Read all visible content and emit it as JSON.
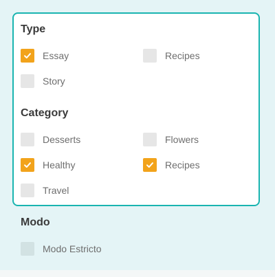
{
  "colors": {
    "accent": "#f2a31b",
    "panel_border": "#19b4b0",
    "unchecked": "#e6e6e6",
    "background": "#e4f4f6"
  },
  "filter_panel": {
    "type": {
      "title": "Type",
      "options": [
        {
          "label": "Essay",
          "checked": true
        },
        {
          "label": "Recipes",
          "checked": false
        },
        {
          "label": "Story",
          "checked": false
        }
      ]
    },
    "category": {
      "title": "Category",
      "options": [
        {
          "label": "Desserts",
          "checked": false
        },
        {
          "label": "Flowers",
          "checked": false
        },
        {
          "label": "Healthy",
          "checked": true
        },
        {
          "label": "Recipes",
          "checked": true
        },
        {
          "label": "Travel",
          "checked": false
        }
      ]
    }
  },
  "mode": {
    "title": "Modo",
    "options": [
      {
        "label": "Modo Estricto",
        "checked": false
      }
    ]
  },
  "icons": {
    "check": "check-icon"
  }
}
